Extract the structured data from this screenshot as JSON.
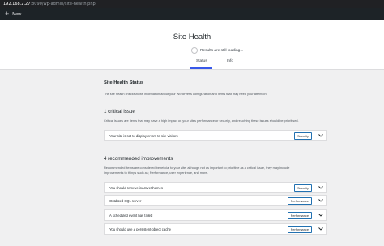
{
  "browser": {
    "url_host": "192.168.2.27",
    "url_path": ":8090/wp-admin/site-health.php"
  },
  "adminbar": {
    "new_label": "New"
  },
  "header": {
    "title": "Site Health",
    "progress_text": "Results are still loading...",
    "tabs": [
      {
        "label": "Status"
      },
      {
        "label": "Info"
      }
    ]
  },
  "status": {
    "title": "Site Health Status",
    "description": "The site health check shows information about your WordPress configuration and items that may need your attention."
  },
  "critical": {
    "heading": "1 critical issue",
    "description": "Critical issues are items that may have a high impact on your sites performance or security, and resolving these issues should be prioritised.",
    "items": [
      {
        "label": "Your site is set to display errors to site visitors",
        "badge": "Security"
      }
    ]
  },
  "recommended": {
    "heading": "4 recommended improvements",
    "description_line1": "Recommended items are considered beneficial to your site, although not as important to prioritise as a critical issue, they may include",
    "description_line2": "improvements to things such as; Performance, user experience, and more.",
    "items": [
      {
        "label": "You should remove inactive themes",
        "badge": "Security"
      },
      {
        "label": "Outdated SQL server",
        "badge": "Performance"
      },
      {
        "label": "A scheduled event has failed",
        "badge": "Performance"
      },
      {
        "label": "You should use a persistent object cache",
        "badge": "Performance"
      }
    ]
  },
  "icons": {
    "plus": "plus-icon",
    "chevron": "chevron-down-icon",
    "progress": "progress-ring-icon"
  },
  "colors": {
    "accent": "#3858e9",
    "badge_border": "#2271b1",
    "adminbar": "#1d2327"
  }
}
